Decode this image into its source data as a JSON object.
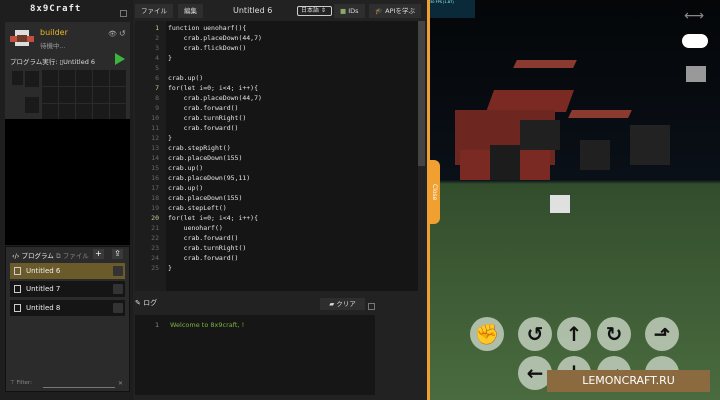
{
  "app": {
    "logo": "8x9Craft",
    "watermark": "LEMONCRAFT.RU"
  },
  "robot": {
    "name": "builder",
    "status": "待機中...",
    "run_label": "プログラム実行:",
    "program": "Untitled 6"
  },
  "programs": {
    "tab_programs": "プログラム",
    "tab_files": "ファイル",
    "add": "+",
    "upload": "⇪",
    "items": [
      {
        "label": "Untitled 6",
        "selected": true
      },
      {
        "label": "Untitled 7"
      },
      {
        "label": "Untitled 8"
      }
    ],
    "filter_label": "Filter:"
  },
  "toolbar": {
    "file": "ファイル",
    "edit": "編集",
    "title": "Untitled 6",
    "language": "日本語",
    "ids": "IDs",
    "learn_api": "APIを学ぶ"
  },
  "code": [
    "function uenoharf(){",
    "    crab.placeDown(44,7)",
    "    crab.flickDown()",
    "}",
    "",
    "crab.up()",
    "for(let i=0; i<4; i++){",
    "    crab.placeDown(44,7)",
    "    crab.forward()",
    "    crab.turnRight()",
    "    crab.forward()",
    "}",
    "crab.stepRight()",
    "crab.placeDown(155)",
    "crab.up()",
    "crab.placeDown(95,11)",
    "crab.up()",
    "crab.placeDown(155)",
    "crab.stepLeft()",
    "for(let i=0; i<4; i++){",
    "    uenoharf()",
    "    crab.forward()",
    "    crab.turnRight()",
    "    crab.forward()",
    "}"
  ],
  "log": {
    "title": "ログ",
    "clear": "クリア",
    "lines": [
      "Welcome to 8x9craft, !"
    ]
  },
  "close_tab": "Close",
  "fps": "30 FPS (1-87)",
  "colors": {
    "accent": "#f0a030",
    "selected": "#6b5a2a",
    "log_text": "#7cb342",
    "robot_name": "#e9b824"
  }
}
